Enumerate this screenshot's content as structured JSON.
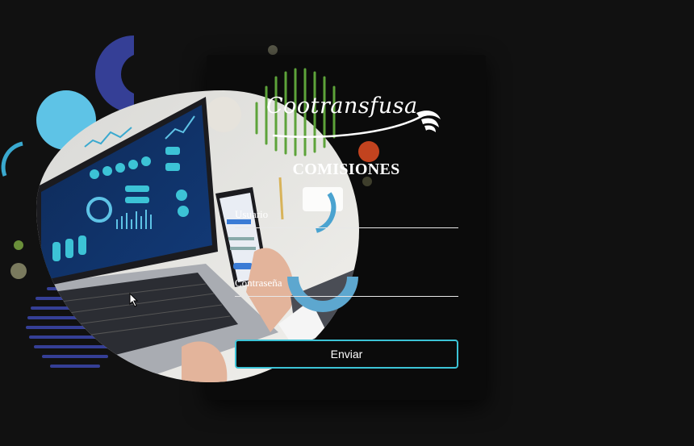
{
  "brand": {
    "logo_text": "Cootransfusa"
  },
  "page": {
    "title": "COMISIONES"
  },
  "form": {
    "username_label": "Usuario",
    "password_label": "Contraseña",
    "submit_label": "Enviar"
  },
  "colors": {
    "background": "#111111",
    "card": "#0b0b0b",
    "accent_cyan": "#3cc3d6",
    "accent_green": "#5da33a",
    "accent_orange": "#c2431f",
    "accent_navy": "#353f96",
    "accent_light_blue": "#5ec3e6"
  }
}
